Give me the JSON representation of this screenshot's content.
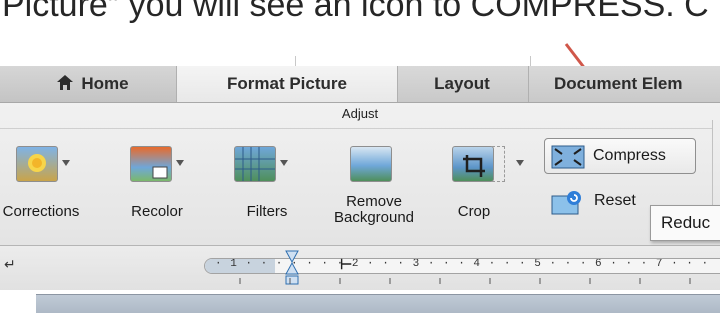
{
  "caption": "Picture” you will see an icon to COMPRESS. C",
  "tabs": {
    "home": "Home",
    "format_picture": "Format Picture",
    "layout": "Layout",
    "document_elements": "Document Elem"
  },
  "ribbon": {
    "group_label": "Adjust",
    "corrections": "Corrections",
    "recolor": "Recolor",
    "filters": "Filters",
    "remove_background_line1": "Remove",
    "remove_background_line2": "Background",
    "crop": "Crop",
    "compress": "Compress",
    "reset": "Reset"
  },
  "tooltip": "Reduc",
  "ruler": {
    "text": "· 1 · · · · · · · 2 · · · 3 · · · 4 · · · 5 · · · 6 · · · 7 · · ·"
  },
  "colors": {
    "arrow": "#d0574a",
    "active_tab": "#efefef",
    "ribbon": "#e9e9e9"
  },
  "icons": {
    "home": "house-icon",
    "arrow": "annotation-arrow",
    "compress": "compress-icon",
    "reset": "reset-icon"
  }
}
